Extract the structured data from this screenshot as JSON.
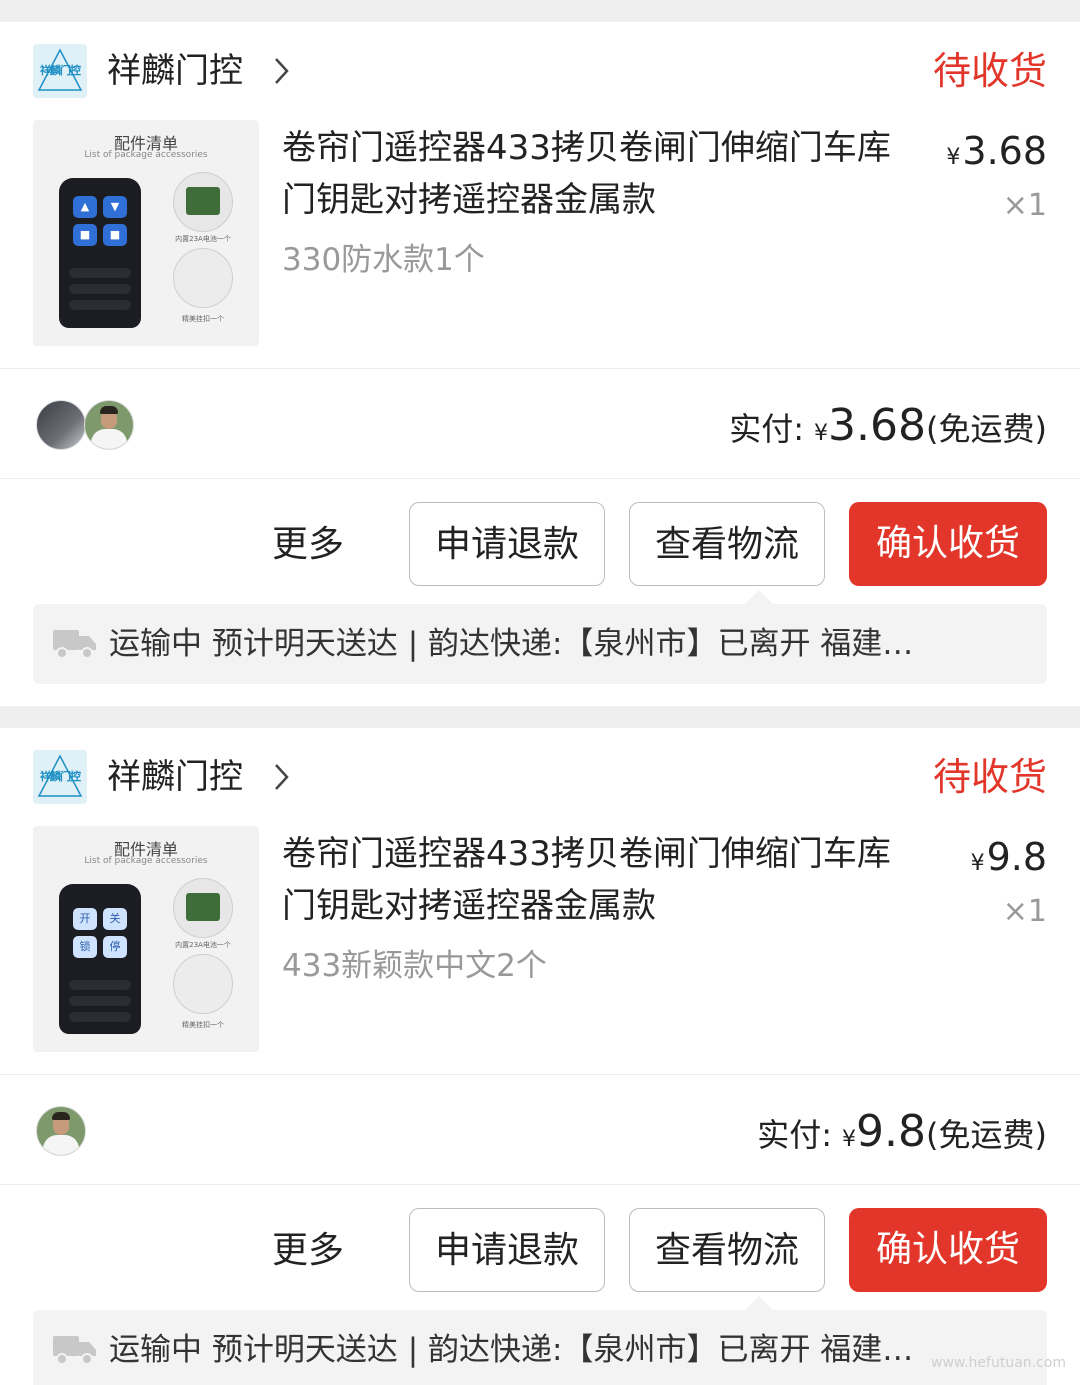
{
  "orders": [
    {
      "shop_name": "祥麟门控",
      "shop_logo_text": "祥麟门控",
      "status": "待收货",
      "thumb_title": "配件清单",
      "thumb_sub": "List of package accessories",
      "thumb_pcb_label": "内置23A电池一个",
      "thumb_key_label": "精美挂扣一个",
      "title": "卷帘门遥控器433拷贝卷闸门伸缩门车库门钥匙对拷遥控器金属款",
      "variant": "330防水款1个",
      "currency": "¥",
      "price": "3.68",
      "qty": "×1",
      "paid_label": "实付:",
      "paid_amount": "3.68",
      "paid_note": "(免运费)",
      "more": "更多",
      "refund": "申请退款",
      "logistics": "查看物流",
      "confirm": "确认收货",
      "shipping": "运输中 预计明天送达 | 韵达快递:【泉州市】已离开 福建…"
    },
    {
      "shop_name": "祥麟门控",
      "shop_logo_text": "祥麟门控",
      "status": "待收货",
      "thumb_title": "配件清单",
      "thumb_sub": "List of package accessories",
      "thumb_pcb_label": "内置23A电池一个",
      "thumb_key_label": "精美挂扣一个",
      "title": "卷帘门遥控器433拷贝卷闸门伸缩门车库门钥匙对拷遥控器金属款",
      "variant": "433新颖款中文2个",
      "currency": "¥",
      "price": "9.8",
      "qty": "×1",
      "paid_label": "实付:",
      "paid_amount": "9.8",
      "paid_note": "(免运费)",
      "more": "更多",
      "refund": "申请退款",
      "logistics": "查看物流",
      "confirm": "确认收货",
      "shipping": "运输中 预计明天送达 | 韵达快递:【泉州市】已离开 福建…"
    }
  ],
  "remote_buttons_order2": [
    "开",
    "关",
    "锁",
    "停"
  ],
  "watermark": "www.hefutuan.com",
  "colors": {
    "accent": "#e2362a",
    "status": "#e2362a"
  }
}
